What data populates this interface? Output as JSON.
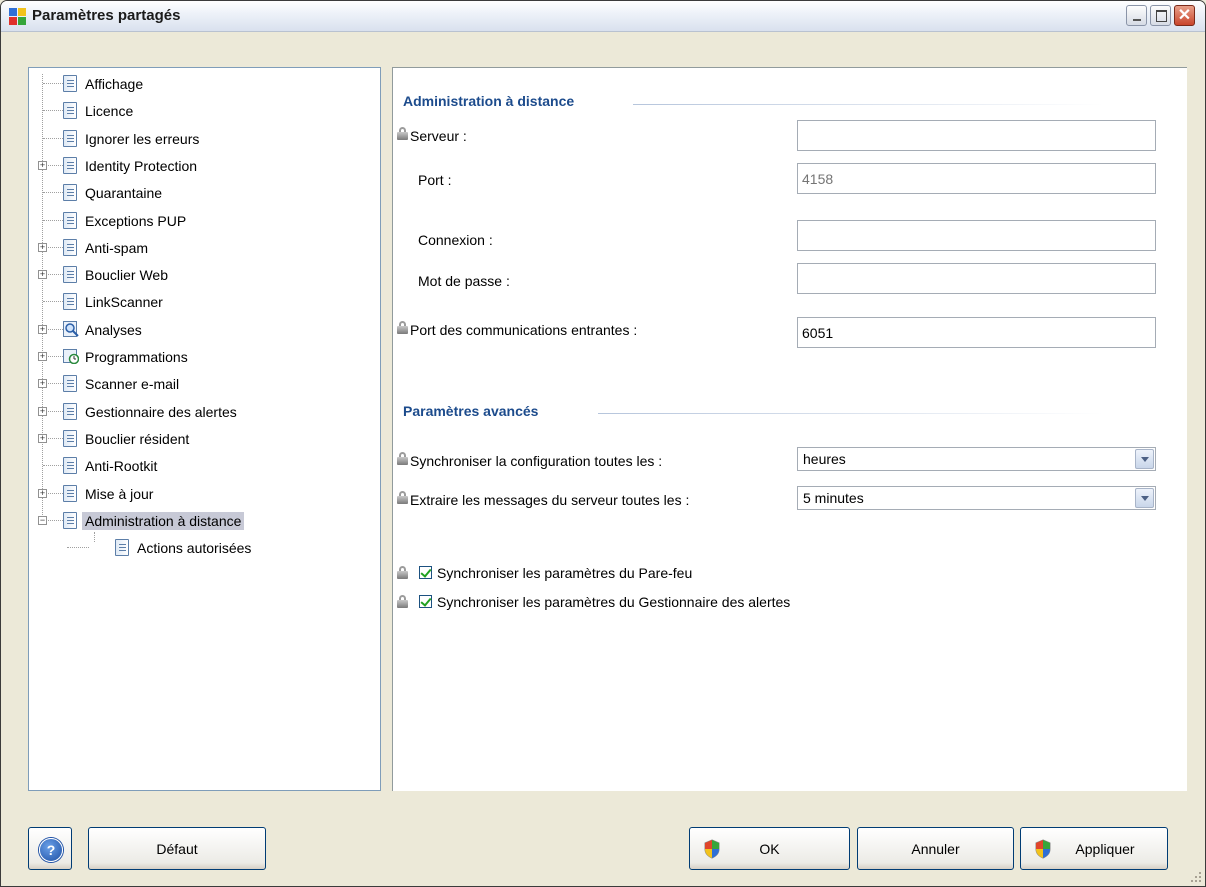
{
  "window": {
    "title": "Paramètres partagés"
  },
  "tree": {
    "items": [
      {
        "label": "Affichage",
        "expandable": false,
        "icon": "document-icon"
      },
      {
        "label": "Licence",
        "expandable": false,
        "icon": "document-icon"
      },
      {
        "label": "Ignorer les erreurs",
        "expandable": false,
        "icon": "document-icon"
      },
      {
        "label": "Identity Protection",
        "expandable": true,
        "icon": "document-icon"
      },
      {
        "label": "Quarantaine",
        "expandable": false,
        "icon": "document-icon"
      },
      {
        "label": "Exceptions PUP",
        "expandable": false,
        "icon": "document-icon"
      },
      {
        "label": "Anti-spam",
        "expandable": true,
        "icon": "document-icon"
      },
      {
        "label": "Bouclier Web",
        "expandable": true,
        "icon": "document-icon"
      },
      {
        "label": "LinkScanner",
        "expandable": false,
        "icon": "document-icon"
      },
      {
        "label": "Analyses",
        "expandable": true,
        "icon": "magnifier-icon"
      },
      {
        "label": "Programmations",
        "expandable": true,
        "icon": "schedule-icon"
      },
      {
        "label": "Scanner e-mail",
        "expandable": true,
        "icon": "document-icon"
      },
      {
        "label": "Gestionnaire des alertes",
        "expandable": true,
        "icon": "document-icon"
      },
      {
        "label": "Bouclier résident",
        "expandable": true,
        "icon": "document-icon"
      },
      {
        "label": "Anti-Rootkit",
        "expandable": false,
        "icon": "document-icon"
      },
      {
        "label": "Mise à jour",
        "expandable": true,
        "icon": "document-icon"
      },
      {
        "label": "Administration à distance",
        "expandable": true,
        "expanded": true,
        "selected": true,
        "icon": "document-icon"
      },
      {
        "label": "Actions autorisées",
        "expandable": false,
        "child": true,
        "icon": "document-icon"
      }
    ]
  },
  "remote_admin": {
    "section_title": "Administration à distance",
    "server_label": "Serveur :",
    "server_value": "",
    "port_label": "Port :",
    "port_placeholder": "4158",
    "login_label": "Connexion :",
    "login_value": "",
    "password_label": "Mot de passe :",
    "password_value": "",
    "incoming_port_label": "Port des communications entrantes :",
    "incoming_port_value": "6051"
  },
  "advanced": {
    "section_title": "Paramètres avancés",
    "sync_config_label": "Synchroniser la configuration toutes les :",
    "sync_config_value": "heures",
    "fetch_messages_label": "Extraire les messages du serveur toutes les :",
    "fetch_messages_value": "5 minutes",
    "sync_firewall_label": "Synchroniser les paramètres du Pare-feu",
    "sync_firewall_checked": true,
    "sync_alerts_label": "Synchroniser les paramètres du Gestionnaire des alertes",
    "sync_alerts_checked": true
  },
  "footer": {
    "help_symbol": "?",
    "default_label": "Défaut",
    "ok_label": "OK",
    "cancel_label": "Annuler",
    "apply_label": "Appliquer"
  },
  "colors": {
    "section_title": "#1c4b8c",
    "selection": "#c7c9d6",
    "close_button": "#c9452c"
  }
}
